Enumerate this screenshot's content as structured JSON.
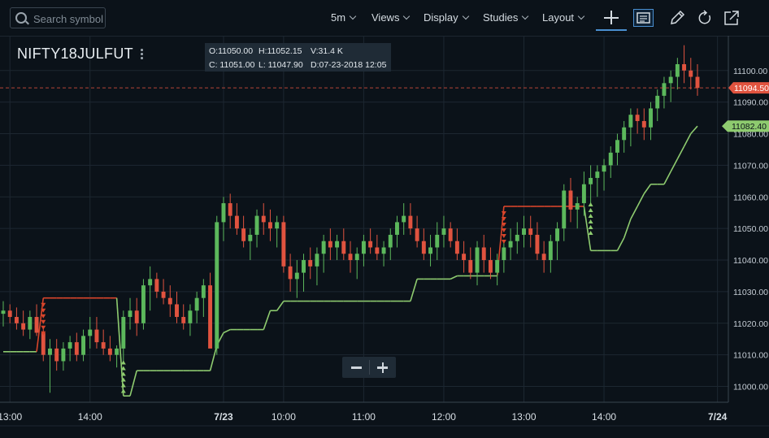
{
  "toolbar": {
    "search_placeholder": "Search symbol",
    "interval": "5m",
    "views": "Views",
    "display": "Display",
    "studies": "Studies",
    "layout": "Layout"
  },
  "symbol": "NIFTY18JULFUT",
  "ohlc": {
    "open": "O:11050.00",
    "high": "H:11052.15",
    "volume": "V:31.4 K",
    "close": "C: 11051.00",
    "low": "L: 11047.90",
    "date": "D:07-23-2018 12:05"
  },
  "colors": {
    "background": "#0b1219",
    "up": "#5cb85c",
    "down": "#e0533f",
    "stop_line_green": "#8ecb6f",
    "stop_line_red": "#d9452b",
    "price_label_red": "#e0533f",
    "price_label_green": "#8ecb6f"
  },
  "chart_data": {
    "type": "candlestick",
    "y_axis": {
      "ticks": [
        "11100.00",
        "11090.00",
        "11080.00",
        "11070.00",
        "11060.00",
        "11050.00",
        "11040.00",
        "11030.00",
        "11020.00",
        "11010.00",
        "11000.00"
      ],
      "range": [
        10995,
        11111
      ]
    },
    "x_axis": {
      "ticks": [
        {
          "label": "13:00",
          "bold": false,
          "index": 1
        },
        {
          "label": "14:00",
          "bold": false,
          "index": 13
        },
        {
          "label": "7/23",
          "bold": true,
          "index": 33
        },
        {
          "label": "10:00",
          "bold": false,
          "index": 42
        },
        {
          "label": "11:00",
          "bold": false,
          "index": 54
        },
        {
          "label": "12:00",
          "bold": false,
          "index": 66
        },
        {
          "label": "13:00",
          "bold": false,
          "index": 78
        },
        {
          "label": "14:00",
          "bold": false,
          "index": 90
        },
        {
          "label": "7/24",
          "bold": true,
          "index": 107
        }
      ]
    },
    "last_price": {
      "value": "11094.50",
      "level": 11094.5
    },
    "stop_level": {
      "value": "11082.40",
      "level": 11082.4
    },
    "ohlc": [
      [
        11023,
        11027,
        11019,
        11024
      ],
      [
        11024,
        11026,
        11020,
        11022
      ],
      [
        11022,
        11025,
        11018,
        11020
      ],
      [
        11020,
        11024,
        11016,
        11018
      ],
      [
        11018,
        11024,
        11015,
        11022
      ],
      [
        11022,
        11026,
        11016,
        11017
      ],
      [
        11017,
        11019,
        11008,
        11010
      ],
      [
        11010,
        11015,
        10998,
        11012
      ],
      [
        11012,
        11015,
        11005,
        11008
      ],
      [
        11008,
        11014,
        11005,
        11012
      ],
      [
        11012,
        11016,
        11008,
        11014
      ],
      [
        11014,
        11017,
        11008,
        11010
      ],
      [
        11010,
        11018,
        11008,
        11016
      ],
      [
        11016,
        11022,
        11012,
        11018
      ],
      [
        11018,
        11022,
        11012,
        11014
      ],
      [
        11014,
        11018,
        11010,
        11012
      ],
      [
        11012,
        11016,
        11008,
        11010
      ],
      [
        11010,
        11013,
        11006,
        11012
      ],
      [
        11012,
        11024,
        11008,
        11022
      ],
      [
        11022,
        11028,
        11018,
        11024
      ],
      [
        11024,
        11028,
        11016,
        11020
      ],
      [
        11020,
        11034,
        11018,
        11032
      ],
      [
        11032,
        11038,
        11024,
        11034
      ],
      [
        11034,
        11036,
        11028,
        11030
      ],
      [
        11030,
        11034,
        11026,
        11028
      ],
      [
        11028,
        11032,
        11022,
        11026
      ],
      [
        11026,
        11030,
        11020,
        11022
      ],
      [
        11022,
        11026,
        11018,
        11020
      ],
      [
        11020,
        11026,
        11016,
        11024
      ],
      [
        11024,
        11030,
        11020,
        11028
      ],
      [
        11028,
        11034,
        11022,
        11032
      ],
      [
        11032,
        11036,
        11020,
        11012
      ],
      [
        11012,
        11054,
        11010,
        11052
      ],
      [
        11052,
        11060,
        11046,
        11058
      ],
      [
        11058,
        11061,
        11050,
        11054
      ],
      [
        11054,
        11058,
        11048,
        11050
      ],
      [
        11050,
        11054,
        11044,
        11046
      ],
      [
        11046,
        11050,
        11040,
        11048
      ],
      [
        11048,
        11056,
        11044,
        11054
      ],
      [
        11054,
        11058,
        11048,
        11052
      ],
      [
        11052,
        11056,
        11046,
        11050
      ],
      [
        11050,
        11054,
        11044,
        11052
      ],
      [
        11052,
        11054,
        11036,
        11038
      ],
      [
        11038,
        11042,
        11030,
        11034
      ],
      [
        11034,
        11040,
        11028,
        11036
      ],
      [
        11036,
        11042,
        11030,
        11040
      ],
      [
        11040,
        11044,
        11034,
        11038
      ],
      [
        11038,
        11044,
        11032,
        11042
      ],
      [
        11042,
        11048,
        11036,
        11046
      ],
      [
        11046,
        11050,
        11040,
        11044
      ],
      [
        11044,
        11048,
        11040,
        11046
      ],
      [
        11046,
        11050,
        11040,
        11042
      ],
      [
        11042,
        11046,
        11036,
        11040
      ],
      [
        11040,
        11044,
        11034,
        11042
      ],
      [
        11042,
        11048,
        11038,
        11046
      ],
      [
        11046,
        11050,
        11042,
        11044
      ],
      [
        11044,
        11048,
        11040,
        11042
      ],
      [
        11042,
        11046,
        11038,
        11044
      ],
      [
        11044,
        11050,
        11040,
        11048
      ],
      [
        11048,
        11054,
        11044,
        11052
      ],
      [
        11052,
        11058,
        11048,
        11054
      ],
      [
        11054,
        11058,
        11048,
        11050
      ],
      [
        11050,
        11054,
        11044,
        11046
      ],
      [
        11046,
        11050,
        11040,
        11042
      ],
      [
        11042,
        11048,
        11038,
        11044
      ],
      [
        11044,
        11052,
        11040,
        11048
      ],
      [
        11048,
        11054,
        11044,
        11050
      ],
      [
        11050,
        11052,
        11044,
        11046
      ],
      [
        11046,
        11050,
        11040,
        11042
      ],
      [
        11042,
        11046,
        11036,
        11040
      ],
      [
        11040,
        11044,
        11034,
        11036
      ],
      [
        11036,
        11046,
        11032,
        11044
      ],
      [
        11044,
        11048,
        11036,
        11040
      ],
      [
        11040,
        11044,
        11034,
        11036
      ],
      [
        11036,
        11042,
        11032,
        11040
      ],
      [
        11040,
        11046,
        11036,
        11044
      ],
      [
        11044,
        11050,
        11040,
        11046
      ],
      [
        11046,
        11052,
        11042,
        11048
      ],
      [
        11048,
        11054,
        11044,
        11050
      ],
      [
        11050,
        11054,
        11044,
        11048
      ],
      [
        11048,
        11052,
        11040,
        11042
      ],
      [
        11042,
        11046,
        11036,
        11040
      ],
      [
        11040,
        11048,
        11036,
        11046
      ],
      [
        11046,
        11052,
        11040,
        11050
      ],
      [
        11050,
        11064,
        11046,
        11062
      ],
      [
        11062,
        11066,
        11052,
        11056
      ],
      [
        11056,
        11060,
        11050,
        11058
      ],
      [
        11058,
        11068,
        11054,
        11064
      ],
      [
        11064,
        11070,
        11058,
        11066
      ],
      [
        11066,
        11070,
        11060,
        11068
      ],
      [
        11068,
        11072,
        11062,
        11070
      ],
      [
        11070,
        11076,
        11066,
        11074
      ],
      [
        11074,
        11080,
        11070,
        11078
      ],
      [
        11078,
        11084,
        11074,
        11082
      ],
      [
        11082,
        11088,
        11076,
        11086
      ],
      [
        11086,
        11088,
        11080,
        11084
      ],
      [
        11084,
        11088,
        11078,
        11082
      ],
      [
        11082,
        11090,
        11078,
        11088
      ],
      [
        11088,
        11094,
        11084,
        11092
      ],
      [
        11092,
        11098,
        11088,
        11096
      ],
      [
        11096,
        11100,
        11090,
        11098
      ],
      [
        11098,
        11104,
        11094,
        11102
      ],
      [
        11102,
        11108,
        11096,
        11100
      ],
      [
        11100,
        11104,
        11094,
        11098
      ],
      [
        11098,
        11102,
        11092,
        11094.5
      ]
    ],
    "stop_line": [
      11011,
      11011,
      11011,
      11011,
      11011,
      11011,
      11028,
      11028,
      11028,
      11028,
      11028,
      11028,
      11028,
      11028,
      11028,
      11028,
      11028,
      11028,
      10997,
      10997,
      11005,
      11005,
      11005,
      11005,
      11005,
      11005,
      11005,
      11005,
      11005,
      11005,
      11005,
      11005,
      11013,
      11017,
      11018,
      11018,
      11018,
      11018,
      11018,
      11018,
      11024,
      11024,
      11027,
      11027,
      11027,
      11027,
      11027,
      11027,
      11027,
      11027,
      11027,
      11027,
      11027,
      11027,
      11027,
      11027,
      11027,
      11027,
      11027,
      11027,
      11027,
      11027,
      11034,
      11034,
      11034,
      11034,
      11034,
      11034,
      11035,
      11035,
      11035,
      11035,
      11035,
      11035,
      11035,
      11057,
      11057,
      11057,
      11057,
      11057,
      11057,
      11057,
      11057,
      11057,
      11057,
      11057,
      11057,
      11057,
      11043,
      11043,
      11043,
      11043,
      11043,
      11047,
      11053,
      11057,
      11061,
      11064,
      11064,
      11064,
      11068,
      11072,
      11076,
      11080,
      11082.4
    ],
    "stop_line_side": [
      "g",
      "g",
      "g",
      "g",
      "g",
      "g",
      "r",
      "r",
      "r",
      "r",
      "r",
      "r",
      "r",
      "r",
      "r",
      "r",
      "r",
      "r",
      "g",
      "g",
      "g",
      "g",
      "g",
      "g",
      "g",
      "g",
      "g",
      "g",
      "g",
      "g",
      "g",
      "g",
      "g",
      "g",
      "g",
      "g",
      "g",
      "g",
      "g",
      "g",
      "g",
      "g",
      "g",
      "g",
      "g",
      "g",
      "g",
      "g",
      "g",
      "g",
      "g",
      "g",
      "g",
      "g",
      "g",
      "g",
      "g",
      "g",
      "g",
      "g",
      "g",
      "g",
      "g",
      "g",
      "g",
      "g",
      "g",
      "g",
      "g",
      "g",
      "g",
      "g",
      "g",
      "g",
      "g",
      "r",
      "r",
      "r",
      "r",
      "r",
      "r",
      "r",
      "r",
      "r",
      "r",
      "r",
      "r",
      "r",
      "g",
      "g",
      "g",
      "g",
      "g",
      "g",
      "g",
      "g",
      "g",
      "g",
      "g",
      "g",
      "g",
      "g",
      "g",
      "g",
      "g"
    ]
  }
}
